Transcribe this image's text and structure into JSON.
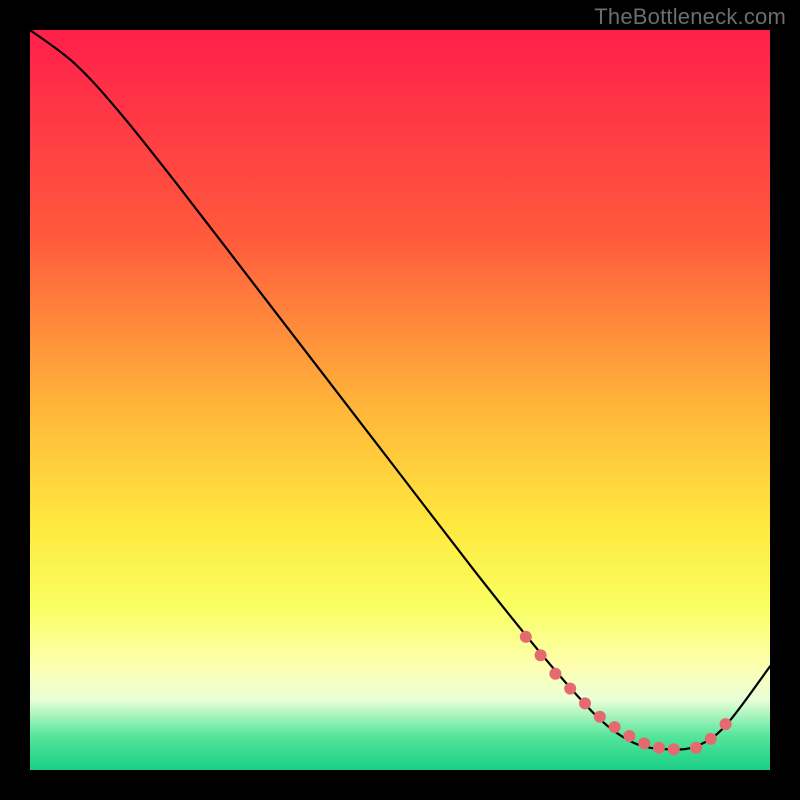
{
  "watermark": "TheBottleneck.com",
  "chart_data": {
    "type": "line",
    "title": "",
    "xlabel": "",
    "ylabel": "",
    "xlim": [
      0,
      100
    ],
    "ylim": [
      0,
      100
    ],
    "grid": false,
    "legend": false,
    "gradient_stops": [
      {
        "t": 0.0,
        "color": "#ff1f4b"
      },
      {
        "t": 0.28,
        "color": "#ff5a3c"
      },
      {
        "t": 0.5,
        "color": "#ffb23a"
      },
      {
        "t": 0.67,
        "color": "#ffe93f"
      },
      {
        "t": 0.78,
        "color": "#f9ff62"
      },
      {
        "t": 0.86,
        "color": "#fdffb0"
      },
      {
        "t": 0.905,
        "color": "#e9ffd7"
      },
      {
        "t": 0.955,
        "color": "#53e59a"
      },
      {
        "t": 1.0,
        "color": "#19cf85"
      }
    ],
    "curve": {
      "x": [
        0,
        6,
        12,
        20,
        30,
        40,
        50,
        60,
        68,
        74,
        78,
        82,
        86,
        90,
        94,
        100
      ],
      "y": [
        100,
        95.5,
        89,
        79,
        66,
        53,
        40,
        27,
        17,
        10,
        6,
        3.5,
        2.8,
        3.2,
        6,
        14
      ]
    },
    "markers": {
      "x": [
        67,
        69,
        71,
        73,
        75,
        77,
        79,
        81,
        83,
        85,
        87,
        90,
        92,
        94
      ],
      "y": [
        18,
        15.5,
        13,
        11,
        9,
        7.2,
        5.8,
        4.6,
        3.6,
        3.0,
        2.8,
        3.0,
        4.2,
        6.2
      ],
      "color": "#e46a6f",
      "radius": 6
    }
  }
}
